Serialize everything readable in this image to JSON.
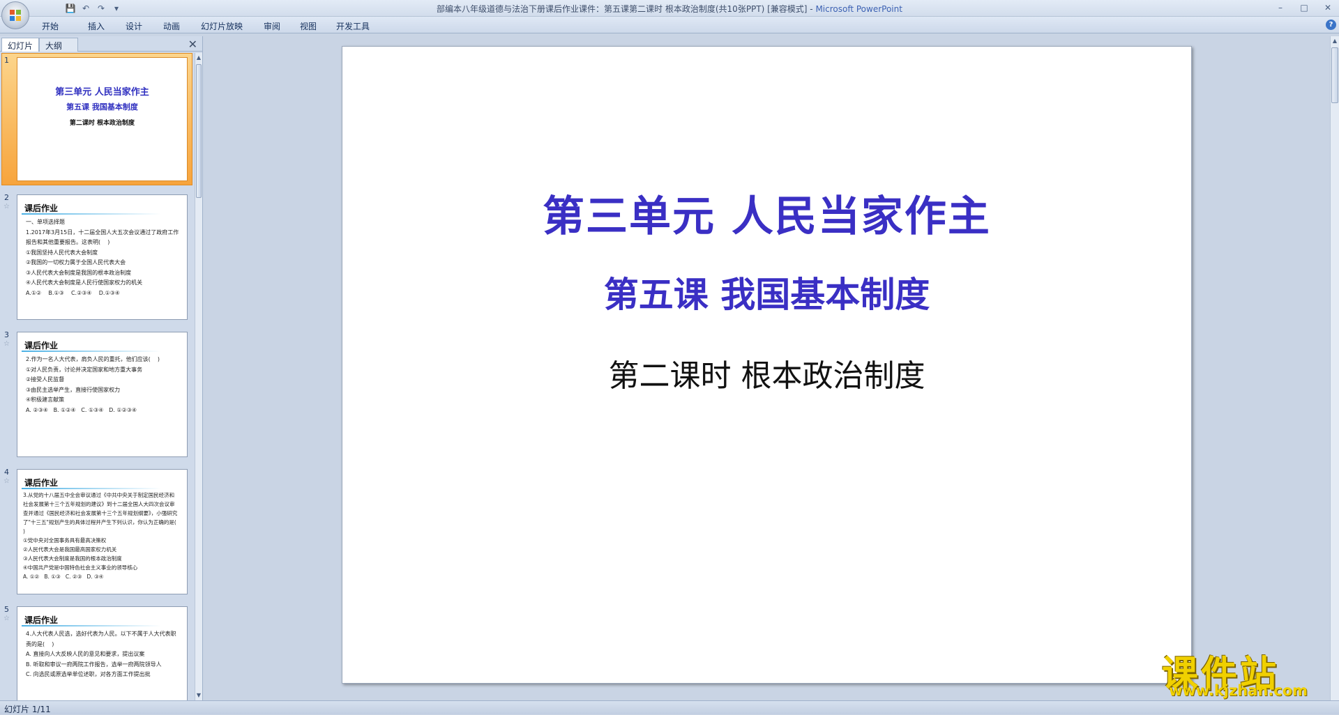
{
  "window": {
    "title_doc": "部编本八年级道德与法治下册课后作业课件：第五课第二课时 根本政治制度(共10张PPT) [兼容模式]",
    "title_sep": " - ",
    "title_app": "Microsoft PowerPoint",
    "minimize": "–",
    "maximize": "□",
    "close": "✕"
  },
  "qat": {
    "save": "💾",
    "undo": "↶",
    "redo": "↷",
    "more": "▾"
  },
  "ribbon": {
    "tabs": [
      "开始",
      "插入",
      "设计",
      "动画",
      "幻灯片放映",
      "审阅",
      "视图",
      "开发工具"
    ],
    "help": "?"
  },
  "pane": {
    "tab_slides": "幻灯片",
    "tab_outline": "大纲",
    "close": "✕",
    "scroll_up": "▲",
    "scroll_down": "▼"
  },
  "thumbnails": [
    {
      "num": "1",
      "lines": [
        "第三单元 人民当家作主",
        "第五课 我国基本制度",
        "第二课时 根本政治制度"
      ]
    },
    {
      "num": "2",
      "star": "☆",
      "head": "课后作业",
      "body": "一、单项选择题\n1.2017年3月15日，十二届全国人大五次会议通过了政府工作报告和其他重要报告。这表明(    )\n①我国坚持人民代表大会制度\n②我国的一切权力属于全国人民代表大会\n③人民代表大会制度是我国的根本政治制度\n④人民代表大会制度是人民行使国家权力的机关\nA.①②    B.①③    C.②③④    D.①③④"
    },
    {
      "num": "3",
      "star": "☆",
      "head": "课后作业",
      "body": "2.作为一名人大代表，肩负人民的重托，他们应该(    )\n①对人民负责，讨论并决定国家和地方重大事务\n②接受人民监督\n③由民主选举产生，直接行使国家权力\n④积极建言献策\nA. ②③④   B. ①②④   C. ①③④   D. ①②③④"
    },
    {
      "num": "4",
      "star": "☆",
      "head": "课后作业",
      "body": "3.从党的十八届五中全会审议通过《中共中央关于制定国民经济和社会发展第十三个五年规划的建议》到十二届全国人大四次会议审查并通过《国民经济和社会发展第十三个五年规划纲要》，小强研究了\"十三五\"规划产生的具体过程并产生下列认识，你认为正确的是(    )\n①党中央对全国事务具有最高决策权\n②人民代表大会是我国最高国家权力机关\n③人民代表大会制度是我国的根本政治制度\n④中国共产党是中国特色社会主义事业的领导核心\nA. ①②   B. ①③   C. ②③   D. ③④"
    },
    {
      "num": "5",
      "star": "☆",
      "head": "课后作业",
      "body": "4.人大代表人民选，选好代表为人民。以下不属于人大代表职责的是(    )\nA. 直接向人大反映人民的意见和要求，提出议案\nB. 听取和审议一府两院工作报告，选举一府两院领导人\nC. 向选民或原选举单位述职，对各方面工作提出批"
    }
  ],
  "slide": {
    "title": "第三单元   人民当家作主",
    "subtitle": "第五课  我国基本制度",
    "lesson": "第二课时   根本政治制度"
  },
  "status": {
    "slide_info": "幻灯片 1/11"
  },
  "watermark": {
    "name": "课件站",
    "url": "www.kjzhan.com"
  }
}
